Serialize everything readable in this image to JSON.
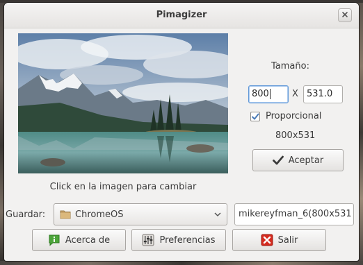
{
  "window": {
    "title": "Pimagizer"
  },
  "preview": {
    "hint": "Click en la imagen para cambiar"
  },
  "size": {
    "label": "Tamaño:",
    "width_value": "800",
    "separator": "X",
    "height_value": "531.0",
    "proportional_label": "Proporcional",
    "proportional_checked": true,
    "result": "800x531"
  },
  "buttons": {
    "accept": "Aceptar",
    "about": "Acerca de",
    "preferences": "Preferencias",
    "quit": "Salir"
  },
  "save": {
    "label": "Guardar:",
    "folder": "ChromeOS",
    "filename": "mikereyfman_6(800x531"
  },
  "icons": {
    "close": "close-icon",
    "checkmark": "checkmark-icon",
    "folder": "folder-icon",
    "chevron": "chevron-down-icon",
    "info": "info-icon",
    "equalizer": "equalizer-icon",
    "quit": "red-x-icon"
  },
  "colors": {
    "accent": "#5f97d8",
    "quit_red": "#d42a1e",
    "info_green": "#4ca53a"
  }
}
